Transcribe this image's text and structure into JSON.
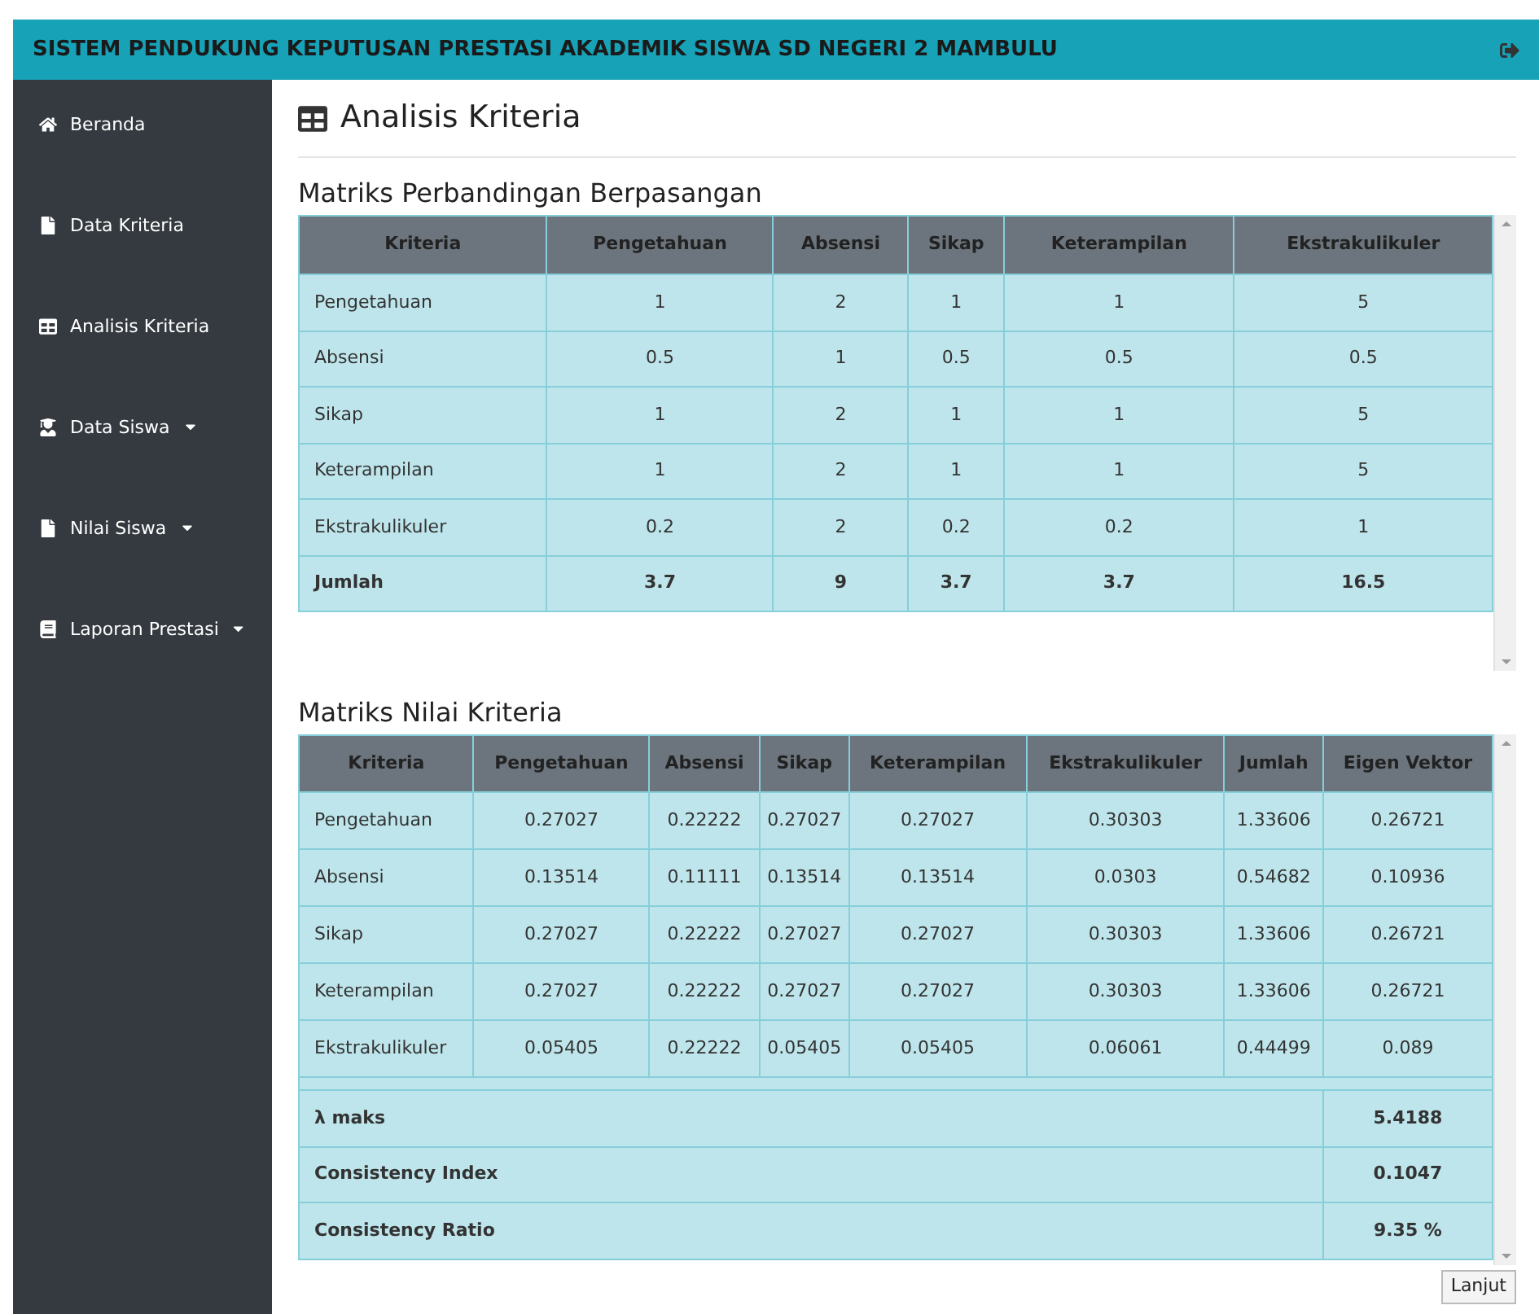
{
  "header": {
    "title": "SISTEM PENDUKUNG KEPUTUSAN PRESTASI AKADEMIK SISWA SD NEGERI 2 MAMBULU"
  },
  "sidebar": {
    "items": [
      {
        "label": "Beranda",
        "kind": "home",
        "dropdown": false
      },
      {
        "label": "Data Kriteria",
        "kind": "file",
        "dropdown": false
      },
      {
        "label": "Analisis Kriteria",
        "kind": "table",
        "dropdown": false
      },
      {
        "label": "Data Siswa",
        "kind": "student",
        "dropdown": true
      },
      {
        "label": "Nilai Siswa",
        "kind": "file",
        "dropdown": true
      },
      {
        "label": "Laporan Prestasi",
        "kind": "book",
        "dropdown": true
      }
    ]
  },
  "page_title": "Analisis Kriteria",
  "comparison_matrix": {
    "title": "Matriks Perbandingan Berpasangan",
    "columns": [
      "Kriteria",
      "Pengetahuan",
      "Absensi",
      "Sikap",
      "Keterampilan",
      "Ekstrakulikuler"
    ],
    "rows": [
      [
        "Pengetahuan",
        "1",
        "2",
        "1",
        "1",
        "5"
      ],
      [
        "Absensi",
        "0.5",
        "1",
        "0.5",
        "0.5",
        "0.5"
      ],
      [
        "Sikap",
        "1",
        "2",
        "1",
        "1",
        "5"
      ],
      [
        "Keterampilan",
        "1",
        "2",
        "1",
        "1",
        "5"
      ],
      [
        "Ekstrakulikuler",
        "0.2",
        "2",
        "0.2",
        "0.2",
        "1"
      ]
    ],
    "total_row": [
      "Jumlah",
      "3.7",
      "9",
      "3.7",
      "3.7",
      "16.5"
    ]
  },
  "value_matrix": {
    "title": "Matriks Nilai Kriteria",
    "columns": [
      "Kriteria",
      "Pengetahuan",
      "Absensi",
      "Sikap",
      "Keterampilan",
      "Ekstrakulikuler",
      "Jumlah",
      "Eigen Vektor"
    ],
    "rows": [
      [
        "Pengetahuan",
        "0.27027",
        "0.22222",
        "0.27027",
        "0.27027",
        "0.30303",
        "1.33606",
        "0.26721"
      ],
      [
        "Absensi",
        "0.13514",
        "0.11111",
        "0.13514",
        "0.13514",
        "0.0303",
        "0.54682",
        "0.10936"
      ],
      [
        "Sikap",
        "0.27027",
        "0.22222",
        "0.27027",
        "0.27027",
        "0.30303",
        "1.33606",
        "0.26721"
      ],
      [
        "Keterampilan",
        "0.27027",
        "0.22222",
        "0.27027",
        "0.27027",
        "0.30303",
        "1.33606",
        "0.26721"
      ],
      [
        "Ekstrakulikuler",
        "0.05405",
        "0.22222",
        "0.05405",
        "0.05405",
        "0.06061",
        "0.44499",
        "0.089"
      ]
    ],
    "summary": [
      {
        "label": "λ maks",
        "value": "5.4188"
      },
      {
        "label": "Consistency Index",
        "value": "0.1047"
      },
      {
        "label": "Consistency Ratio",
        "value": "9.35 %"
      }
    ]
  },
  "next_button": "Lanjut"
}
